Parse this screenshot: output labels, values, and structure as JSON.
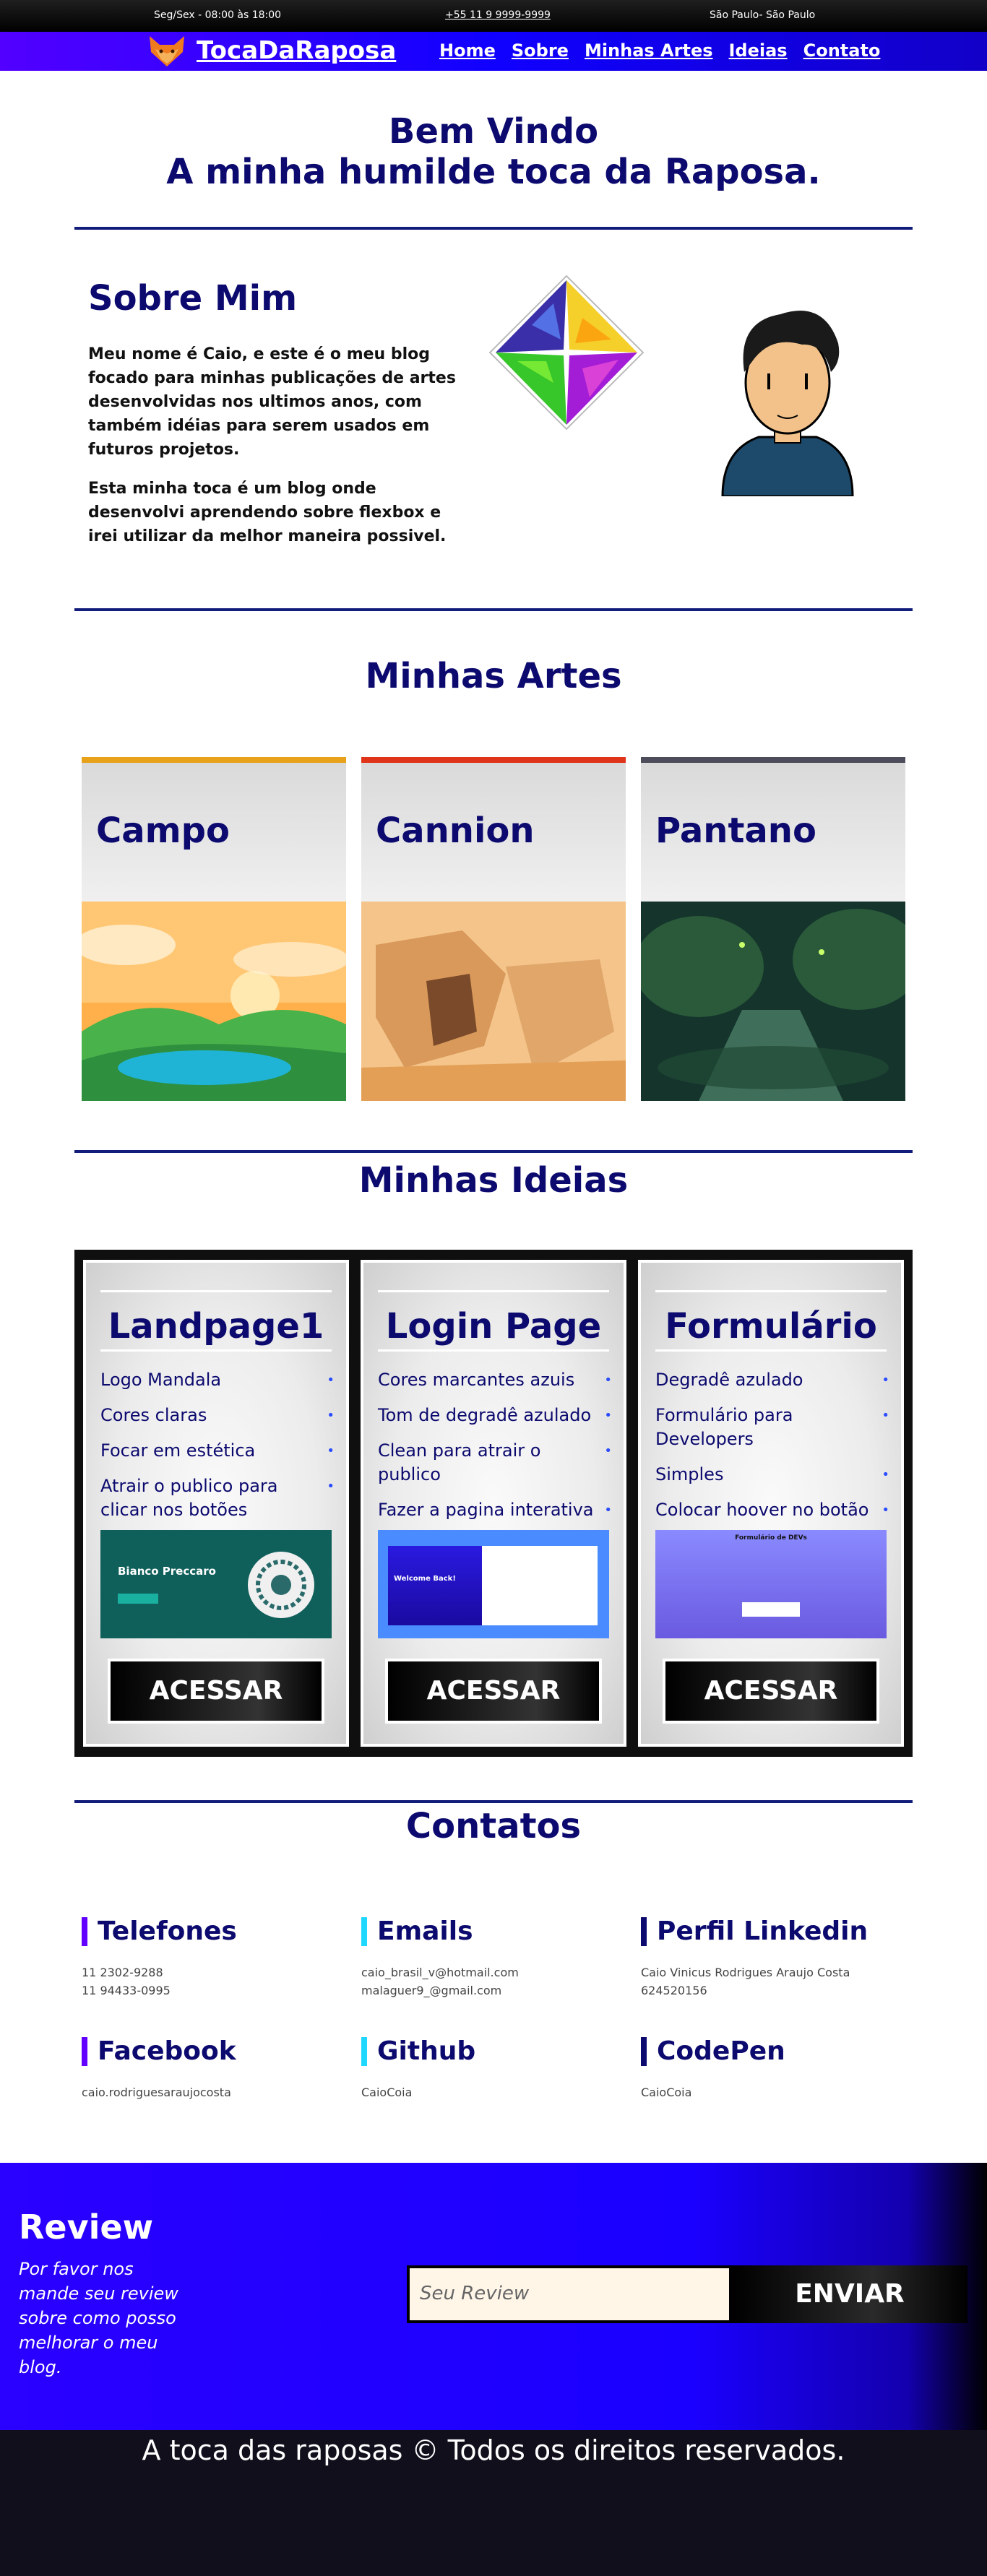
{
  "topbar": {
    "hours": "Seg/Sex - 08:00 às 18:00",
    "phone": "+55 11 9 9999-9999",
    "city": "São Paulo- São Paulo"
  },
  "nav": {
    "brand": "TocaDaRaposa",
    "items": [
      "Home",
      "Sobre",
      "Minhas Artes",
      "Ideias",
      "Contato"
    ]
  },
  "hero": {
    "line1": "Bem Vindo",
    "line2": "A minha humilde toca da Raposa."
  },
  "about": {
    "title": "Sobre Mim",
    "p1": "Meu nome é Caio, e este é o meu blog focado para minhas publicações de artes desenvolvidas nos ultimos anos, com também idéias para serem usados em futuros projetos.",
    "p2": "Esta minha toca é um blog onde desenvolvi aprendendo sobre flexbox e irei utilizar da melhor maneira possivel."
  },
  "arts": {
    "title": "Minhas Artes",
    "cards": [
      {
        "title": "Campo",
        "accent": "#e8a21a"
      },
      {
        "title": "Cannion",
        "accent": "#e0341a"
      },
      {
        "title": "Pantano",
        "accent": "#4c4c5a"
      }
    ]
  },
  "ideas": {
    "title": "Minhas Ideias",
    "cards": [
      {
        "title": "Landpage1",
        "items": [
          "Logo Mandala",
          "Cores claras",
          "Focar em estética",
          "Atrair o publico para clicar nos botões"
        ],
        "shot_title": "Bianco Preccaro",
        "button": "ACESSAR"
      },
      {
        "title": "Login Page",
        "items": [
          "Cores marcantes azuis",
          "Tom de degradê azulado",
          "Clean para atrair o publico",
          "Fazer a pagina interativa"
        ],
        "shot_title": "Welcome Back!",
        "button": "ACESSAR"
      },
      {
        "title": "Formulário",
        "items": [
          "Degradê azulado",
          "Formulário para Developers",
          "Simples",
          "Colocar hoover no botão"
        ],
        "shot_title": "Formulário de DEVs",
        "button": "ACESSAR"
      }
    ]
  },
  "contacts": {
    "title": "Contatos",
    "items": [
      {
        "title": "Telefones",
        "values": [
          "11 2302-9288",
          "11 94433-0995"
        ],
        "bar": "#6100ff"
      },
      {
        "title": "Emails",
        "values": [
          "caio_brasil_v@hotmail.com",
          "malaguer9_@gmail.com"
        ],
        "bar": "#1fd8ff"
      },
      {
        "title": "Perfil Linkedin",
        "values": [
          "Caio Vinicus Rodrigues Araujo Costa",
          "624520156"
        ],
        "bar": "#0c0a6e"
      },
      {
        "title": "Facebook",
        "values": [
          "caio.rodriguesaraujocosta"
        ],
        "bar": "#6100ff"
      },
      {
        "title": "Github",
        "values": [
          "CaioCoia"
        ],
        "bar": "#1fd8ff"
      },
      {
        "title": "CodePen",
        "values": [
          "CaioCoia"
        ],
        "bar": "#0c0a6e"
      }
    ]
  },
  "review": {
    "title": "Review",
    "text": "Por favor nos mande seu review sobre como posso melhorar o meu blog.",
    "placeholder": "Seu Review",
    "button": "ENVIAR"
  },
  "footer": {
    "text": "A toca das raposas © Todos os direitos reservados."
  }
}
